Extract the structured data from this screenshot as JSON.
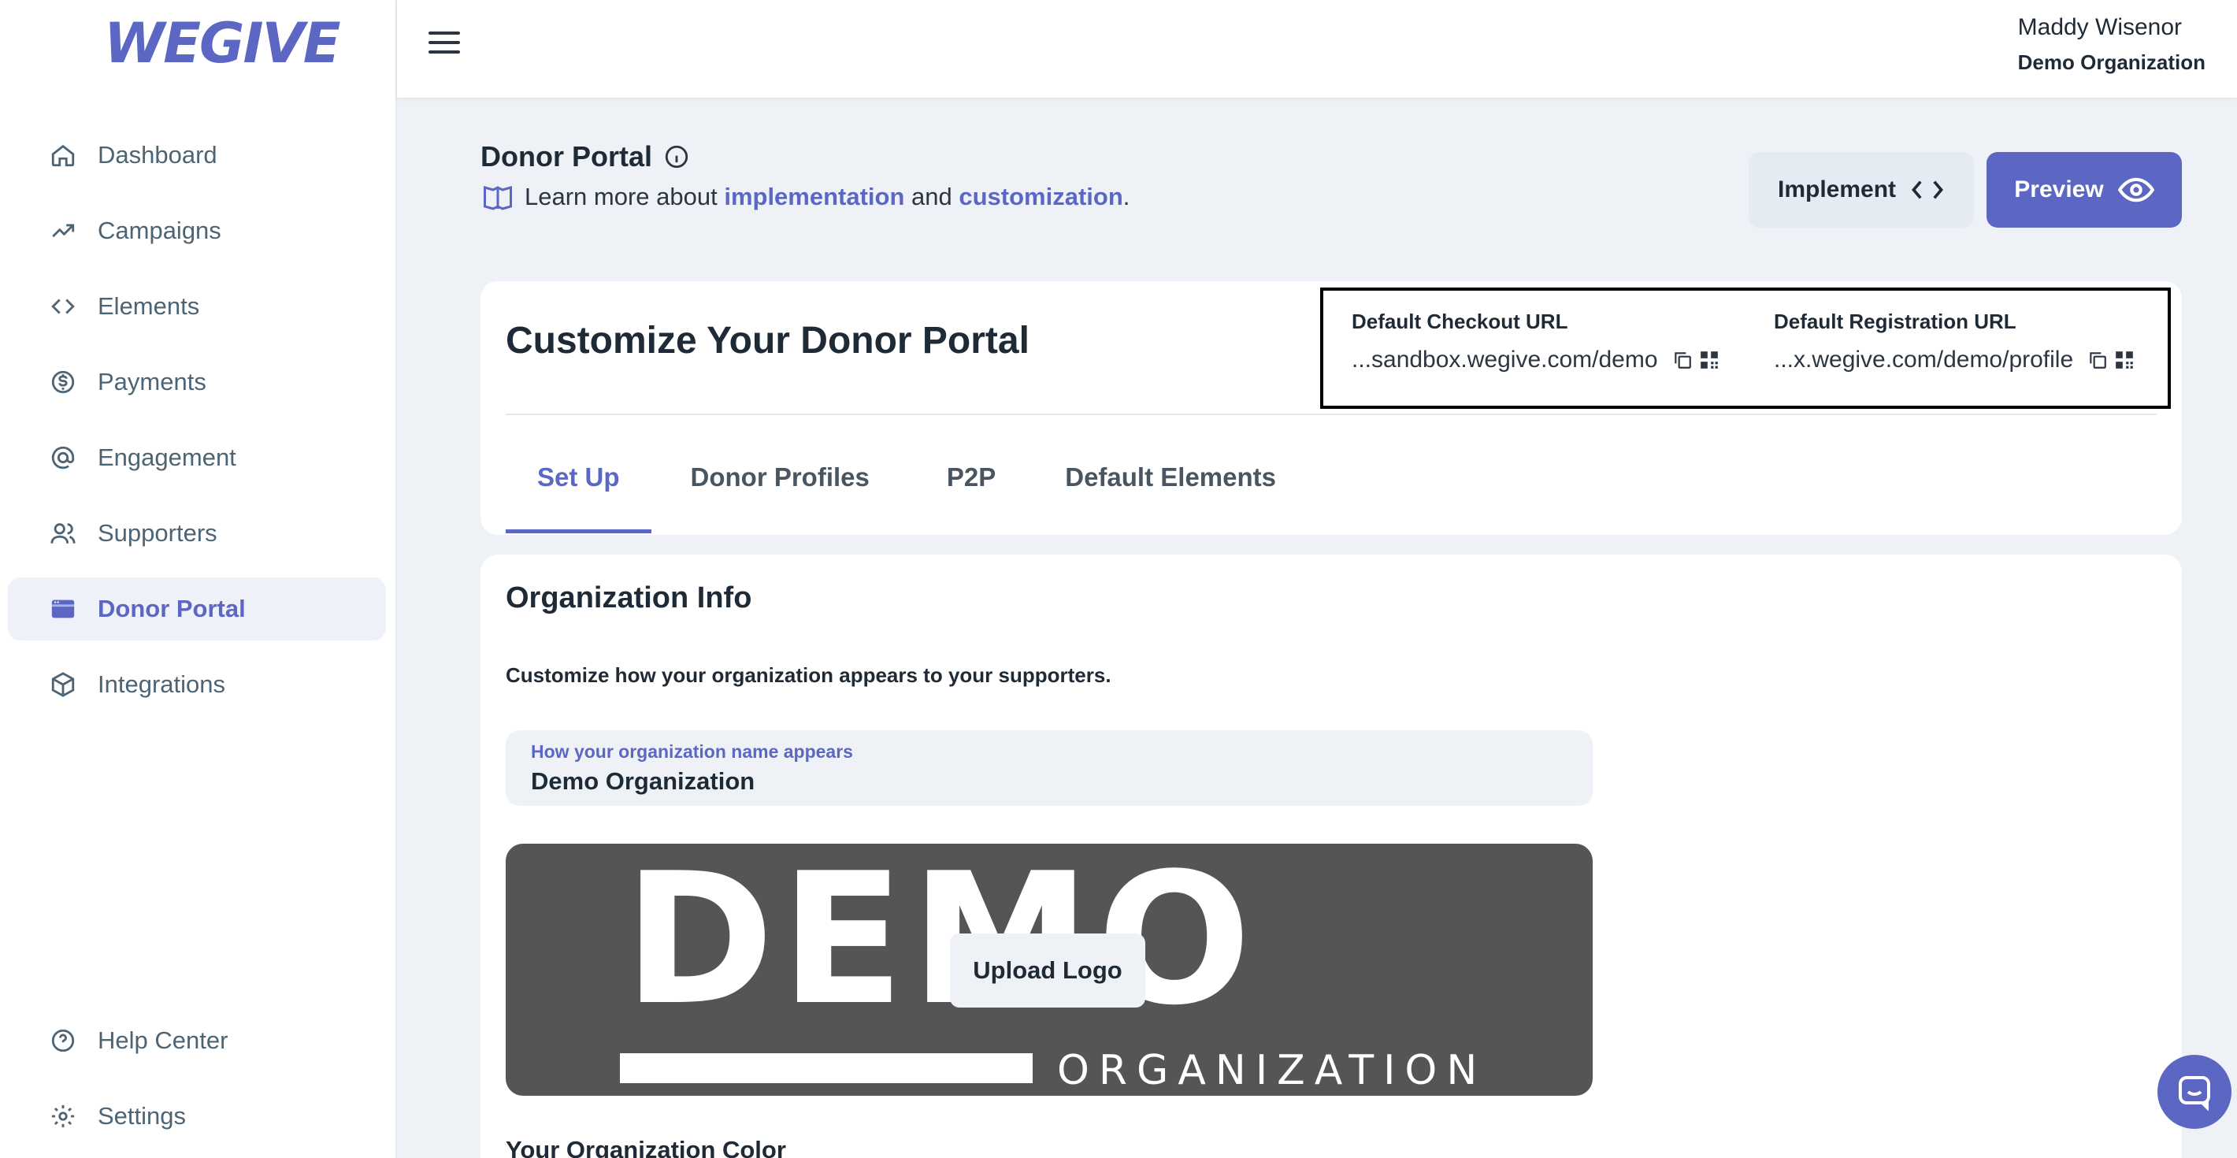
{
  "brand": {
    "logo_text": "WEGIVE",
    "accent": "#5b67c2"
  },
  "sidebar": {
    "items": [
      {
        "label": "Dashboard",
        "icon": "home-icon"
      },
      {
        "label": "Campaigns",
        "icon": "trending-up-icon"
      },
      {
        "label": "Elements",
        "icon": "code-icon"
      },
      {
        "label": "Payments",
        "icon": "dollar-circle-icon"
      },
      {
        "label": "Engagement",
        "icon": "at-sign-icon"
      },
      {
        "label": "Supporters",
        "icon": "users-icon"
      },
      {
        "label": "Donor Portal",
        "icon": "browser-window-icon",
        "active": true
      },
      {
        "label": "Integrations",
        "icon": "cube-icon"
      }
    ],
    "bottom_items": [
      {
        "label": "Help Center",
        "icon": "help-circle-icon"
      },
      {
        "label": "Settings",
        "icon": "gear-icon"
      }
    ]
  },
  "header": {
    "user_name": "Maddy Wisenor",
    "user_org": "Demo Organization"
  },
  "page": {
    "title": "Donor Portal",
    "learn_prefix": "Learn more about ",
    "learn_link1": "implementation",
    "learn_mid": " and ",
    "learn_link2": "customization",
    "learn_suffix": ".",
    "implement_label": "Implement",
    "preview_label": "Preview"
  },
  "customize": {
    "title": "Customize Your Donor Portal",
    "checkout_label": "Default Checkout URL",
    "checkout_url": "...sandbox.wegive.com/demo",
    "registration_label": "Default Registration URL",
    "registration_url": "...x.wegive.com/demo/profile",
    "tabs": [
      "Set Up",
      "Donor Profiles",
      "P2P",
      "Default Elements"
    ],
    "active_tab": "Set Up"
  },
  "org_info": {
    "title": "Organization Info",
    "description": "Customize how your organization appears to your supporters.",
    "name_label": "How your organization name appears",
    "name_value": "Demo Organization",
    "logo_text_big": "DEMO",
    "logo_text_small": "ORGANIZATION",
    "upload_label": "Upload Logo",
    "color_title": "Your Organization Color"
  }
}
